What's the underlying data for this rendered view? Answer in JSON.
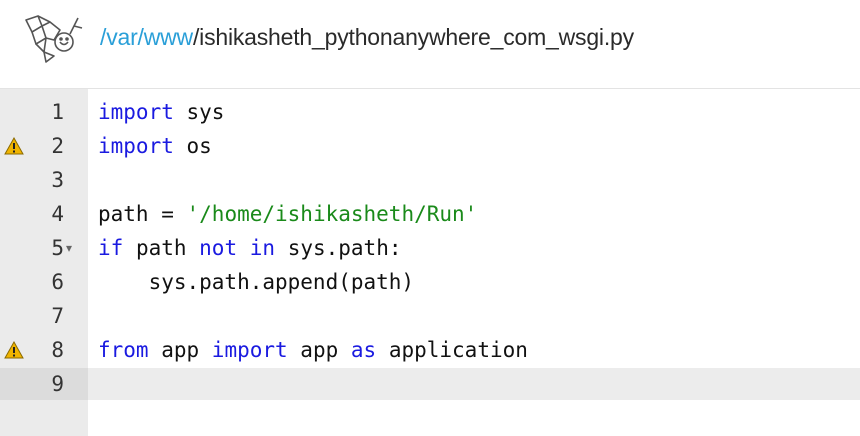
{
  "header": {
    "path_segments": [
      {
        "text": "/var",
        "link": true
      },
      {
        "text": "/www",
        "link": true
      },
      {
        "text": "/ishikasheth_pythonanywhere_com_wsgi.py",
        "link": false
      }
    ],
    "logo_icon": "pythonanywhere-logo-icon"
  },
  "editor": {
    "lines": [
      {
        "number": "1",
        "warning": false,
        "fold": false,
        "tokens": [
          {
            "t": "import",
            "k": "kw"
          },
          {
            "t": " sys",
            "k": "plain"
          }
        ]
      },
      {
        "number": "2",
        "warning": true,
        "fold": false,
        "tokens": [
          {
            "t": "import",
            "k": "kw"
          },
          {
            "t": " os",
            "k": "plain"
          }
        ]
      },
      {
        "number": "3",
        "warning": false,
        "fold": false,
        "tokens": []
      },
      {
        "number": "4",
        "warning": false,
        "fold": false,
        "tokens": [
          {
            "t": "path = ",
            "k": "plain"
          },
          {
            "t": "'/home/ishikasheth/Run'",
            "k": "str"
          }
        ]
      },
      {
        "number": "5",
        "warning": false,
        "fold": true,
        "tokens": [
          {
            "t": "if",
            "k": "kw"
          },
          {
            "t": " path ",
            "k": "plain"
          },
          {
            "t": "not",
            "k": "kw"
          },
          {
            "t": " ",
            "k": "plain"
          },
          {
            "t": "in",
            "k": "kw"
          },
          {
            "t": " sys.path:",
            "k": "plain"
          }
        ]
      },
      {
        "number": "6",
        "warning": false,
        "fold": false,
        "tokens": [
          {
            "t": "    sys.path.append(path)",
            "k": "plain"
          }
        ]
      },
      {
        "number": "7",
        "warning": false,
        "fold": false,
        "tokens": []
      },
      {
        "number": "8",
        "warning": true,
        "fold": false,
        "tokens": [
          {
            "t": "from",
            "k": "kw"
          },
          {
            "t": " app ",
            "k": "plain"
          },
          {
            "t": "import",
            "k": "kw"
          },
          {
            "t": " app ",
            "k": "plain"
          },
          {
            "t": "as",
            "k": "kw"
          },
          {
            "t": " application",
            "k": "plain"
          }
        ]
      },
      {
        "number": "9",
        "warning": false,
        "fold": false,
        "tokens": []
      }
    ],
    "colors": {
      "keyword": "#1a1ae0",
      "string": "#1a8a1a",
      "link": "#2a9fd8",
      "warning": "#f0b400"
    }
  }
}
